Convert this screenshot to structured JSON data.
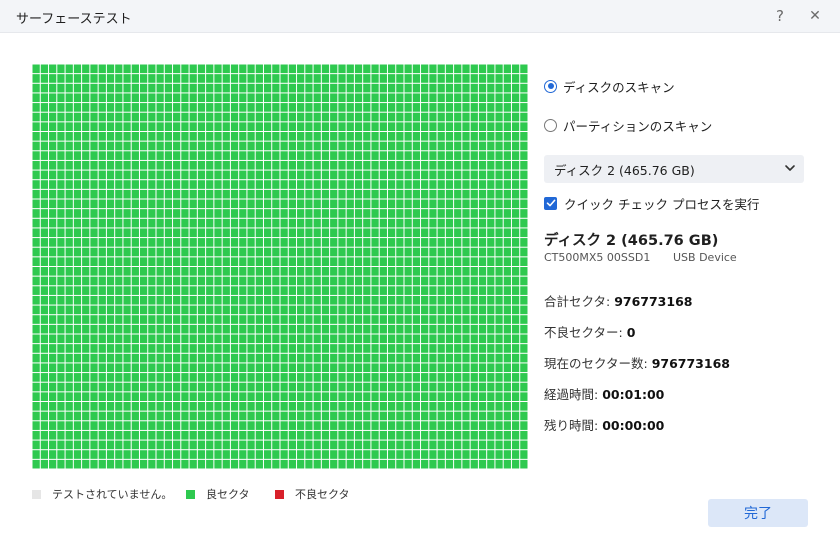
{
  "window": {
    "title": "サーフェーステスト",
    "help_glyph": "?",
    "close_glyph": "✕"
  },
  "scan_map": {
    "total_cells": 2520,
    "good_fraction": 1.0,
    "colors": {
      "good": "#2ec94f",
      "bad": "#d8202a",
      "untested": "#e6e6e6"
    }
  },
  "legend": {
    "untested": "テストされていません。",
    "good": "良セクタ",
    "bad": "不良セクタ"
  },
  "options": {
    "scan_disk": "ディスクのスキャン",
    "scan_partition": "パーティションのスキャン",
    "selected": "scan_disk",
    "disk_select": "ディスク 2 (465.76 GB)",
    "quick_check": "クイック チェック プロセスを実行",
    "quick_check_checked": true
  },
  "disk": {
    "title": "ディスク 2 (465.76 GB)",
    "model": "CT500MX5 00SSD1",
    "type": "USB Device"
  },
  "stats": {
    "total_label": "合計セクタ: ",
    "total_value": "976773168",
    "bad_label": "不良セクター: ",
    "bad_value": "0",
    "current_label": "現在のセクター数: ",
    "current_value": "976773168",
    "elapsed_label": "経過時間: ",
    "elapsed_value": "00:01:00",
    "remaining_label": "残り時間: ",
    "remaining_value": "00:00:00"
  },
  "buttons": {
    "done": "完了"
  },
  "accent": "#2168d6"
}
